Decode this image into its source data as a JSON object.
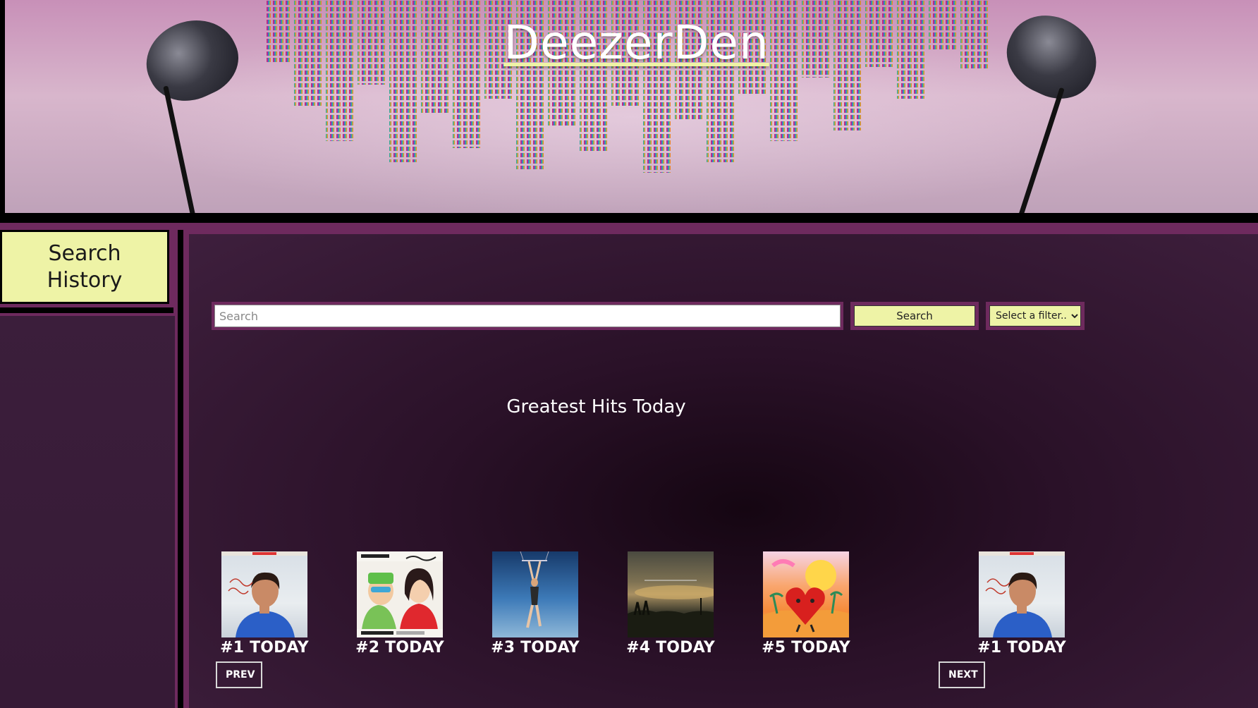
{
  "header": {
    "site_title": "DeezerDen"
  },
  "sidebar": {
    "history_button_label": "Search\nHistory"
  },
  "search": {
    "placeholder": "Search",
    "value": "",
    "button_label": "Search",
    "filter_selected": "Select a filter..."
  },
  "main": {
    "section_title": "Greatest Hits Today",
    "cards": [
      {
        "label": "#1 TODAY",
        "art": "person-blue-shirt"
      },
      {
        "label": "#2 TODAY",
        "art": "cold-heart-duo"
      },
      {
        "label": "#3 TODAY",
        "art": "figure-on-swing"
      },
      {
        "label": "#4 TODAY",
        "art": "sunset-field"
      },
      {
        "label": "#5 TODAY",
        "art": "red-heart-beach"
      },
      {
        "label": "#1 TODAY",
        "art": "person-blue-shirt"
      }
    ],
    "prev_label": "PREV",
    "next_label": "NEXT"
  },
  "colors": {
    "accent_yellow": "#eef3a6",
    "frame_purple": "#6e2a5e",
    "panel_dark": "#2a1128"
  }
}
